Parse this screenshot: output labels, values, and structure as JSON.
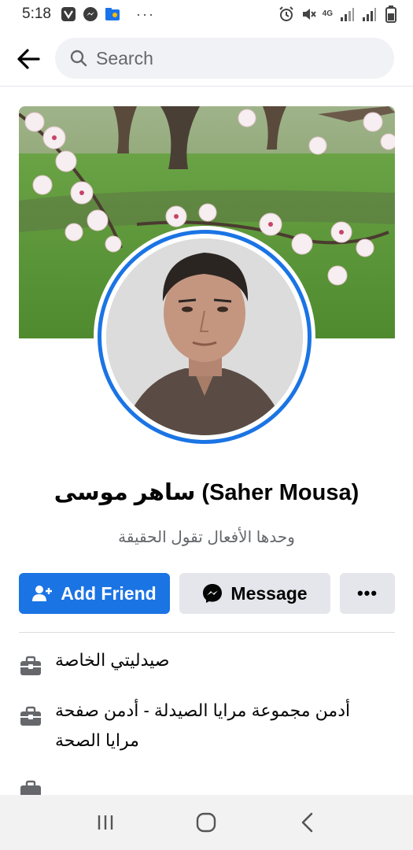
{
  "status_bar": {
    "time": "5:18",
    "more_label": "···",
    "network_label": "4G"
  },
  "search": {
    "placeholder": "Search"
  },
  "profile": {
    "name": "ساهر موسى (Saher Mousa)",
    "bio": "وحدها الأفعال تقول الحقيقة"
  },
  "actions": {
    "add_friend": "Add Friend",
    "message": "Message",
    "more": "•••"
  },
  "details": [
    {
      "icon": "briefcase-icon",
      "text": "صيدليتي الخاصة"
    },
    {
      "icon": "briefcase-icon",
      "text": "أدمن مجموعة مرايا الصيدلة - أدمن صفحة مرايا الصحة"
    }
  ],
  "colors": {
    "accent": "#1b74e4",
    "secondary_button": "#e4e6eb",
    "muted_text": "#65676b"
  }
}
